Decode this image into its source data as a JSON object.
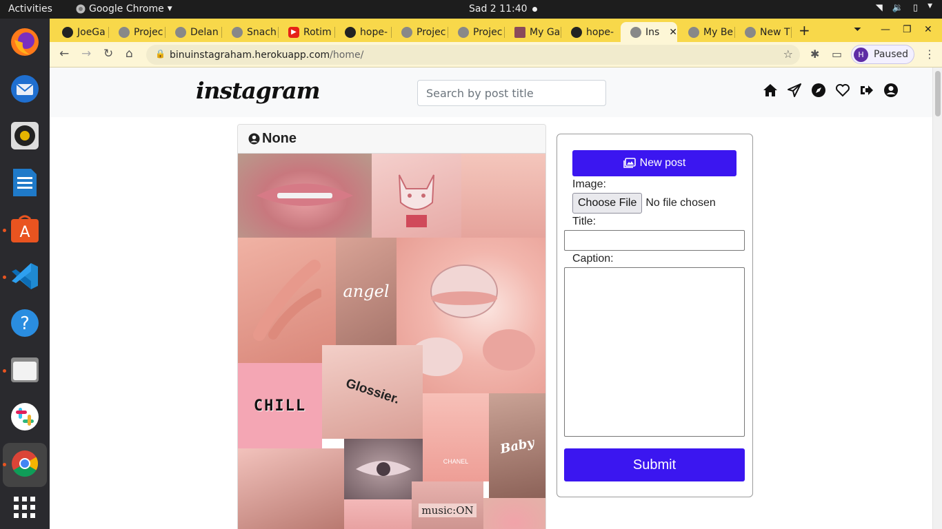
{
  "system": {
    "activities": "Activities",
    "app_name": "Google Chrome",
    "clock": "Sad 2  11:40"
  },
  "dock": {
    "items": [
      "firefox-icon",
      "thunderbird-icon",
      "rhythmbox-icon",
      "writer-icon",
      "software-icon",
      "vscode-icon",
      "help-icon",
      "files-icon",
      "slack-icon",
      "chrome-icon",
      "apps-grid-icon"
    ]
  },
  "browser": {
    "tabs": [
      {
        "label": "JoeGa",
        "favicon": "github-icon"
      },
      {
        "label": "Projec",
        "favicon": "globe-icon"
      },
      {
        "label": "Delan",
        "favicon": "globe-icon"
      },
      {
        "label": "Snach",
        "favicon": "globe-icon"
      },
      {
        "label": "Rotim",
        "favicon": "youtube-icon"
      },
      {
        "label": "hope-",
        "favicon": "github-icon"
      },
      {
        "label": "Projec",
        "favicon": "globe-icon"
      },
      {
        "label": "Projec",
        "favicon": "globe-icon"
      },
      {
        "label": "My Ga",
        "favicon": "image-icon"
      },
      {
        "label": "hope-",
        "favicon": "github-icon"
      },
      {
        "label": "Ins",
        "favicon": "globe-icon",
        "active": true
      },
      {
        "label": "My Be",
        "favicon": "globe-icon"
      },
      {
        "label": "New T",
        "favicon": "globe-icon"
      }
    ],
    "url_host": "binuinstagraham.herokuapp.com",
    "url_path": "/home/",
    "profile_initial": "H",
    "profile_status": "Paused"
  },
  "site": {
    "logo": "instagram",
    "search_placeholder": "Search by post title",
    "nav_icons": [
      "home-icon",
      "send-icon",
      "explore-icon",
      "heart-icon",
      "logout-icon",
      "profile-icon"
    ]
  },
  "post": {
    "username": "None",
    "collage_text": {
      "angel": "angel",
      "chill": "CHILL",
      "glossier": "Glossier.",
      "baby": "Baby",
      "music": "music:ON",
      "chanel": "CHANEL"
    }
  },
  "form": {
    "new_post_label": "New post",
    "image_label": "Image:",
    "choose_file_label": "Choose File",
    "no_file_text": "No file chosen",
    "title_label": "Title:",
    "caption_label": "Caption:",
    "submit_label": "Submit"
  },
  "colors": {
    "accent": "#3b16f0",
    "chrome_frame": "#f8d84a",
    "pink_tiles": [
      "#e8a8a0",
      "#f0b8b0",
      "#c98a80",
      "#f4a6b4",
      "#e9b0a2"
    ]
  }
}
